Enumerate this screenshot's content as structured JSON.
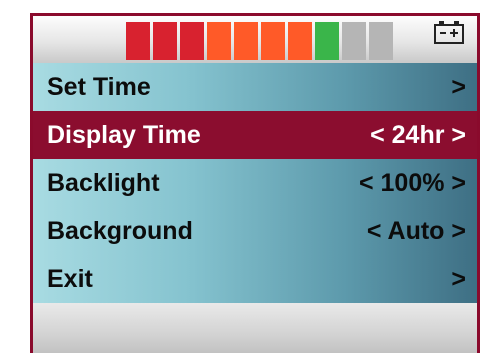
{
  "header": {
    "battery_segments": [
      "#d8222f",
      "#d8222f",
      "#d8222f",
      "#ff5a28",
      "#ff5a28",
      "#ff5a28",
      "#ff5a28",
      "#3ab54a",
      "#b5b5b5",
      "#b5b5b5"
    ],
    "battery_icon": "battery-icon"
  },
  "menu": {
    "items": [
      {
        "label": "Set Time",
        "value": ">"
      },
      {
        "label": "Display Time",
        "value": "< 24hr >"
      },
      {
        "label": "Backlight",
        "value": "< 100% >"
      },
      {
        "label": "Background",
        "value": "< Auto >"
      },
      {
        "label": "Exit",
        "value": ">"
      }
    ],
    "selected_index": 1
  },
  "colors": {
    "frame": "#8a0a2c",
    "highlight": "#8b0d2f"
  }
}
